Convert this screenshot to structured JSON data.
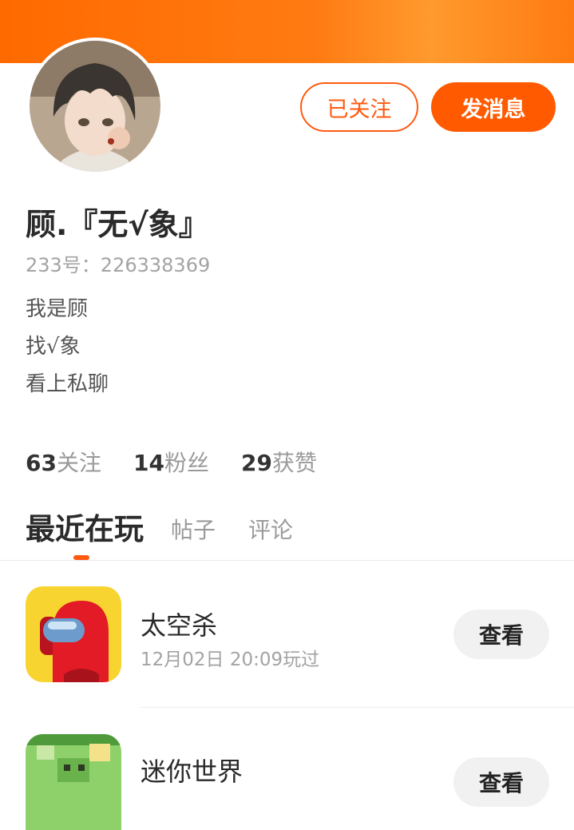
{
  "profile": {
    "name": "顾.『无√象』",
    "id_line": "233号：226338369",
    "bio": [
      "我是顾",
      "找√象",
      "看上私聊"
    ]
  },
  "actions": {
    "follow_label": "已关注",
    "message_label": "发消息"
  },
  "stats": [
    {
      "value": "63",
      "label": "关注"
    },
    {
      "value": "14",
      "label": "粉丝"
    },
    {
      "value": "29",
      "label": "获赞"
    }
  ],
  "tabs": [
    {
      "label": "最近在玩",
      "active": true
    },
    {
      "label": "帖子",
      "active": false
    },
    {
      "label": "评论",
      "active": false
    }
  ],
  "games": [
    {
      "name": "太空杀",
      "last_played": "12月02日 20:09玩过",
      "button_label": "查看",
      "icon": "red-crewmate-icon"
    },
    {
      "name": "迷你世界",
      "last_played": "",
      "button_label": "查看",
      "icon": "mini-world-icon"
    }
  ],
  "colors": {
    "accent": "#ff5a00",
    "banner": "#ff7b12",
    "muted_text": "#a3a3a3"
  }
}
